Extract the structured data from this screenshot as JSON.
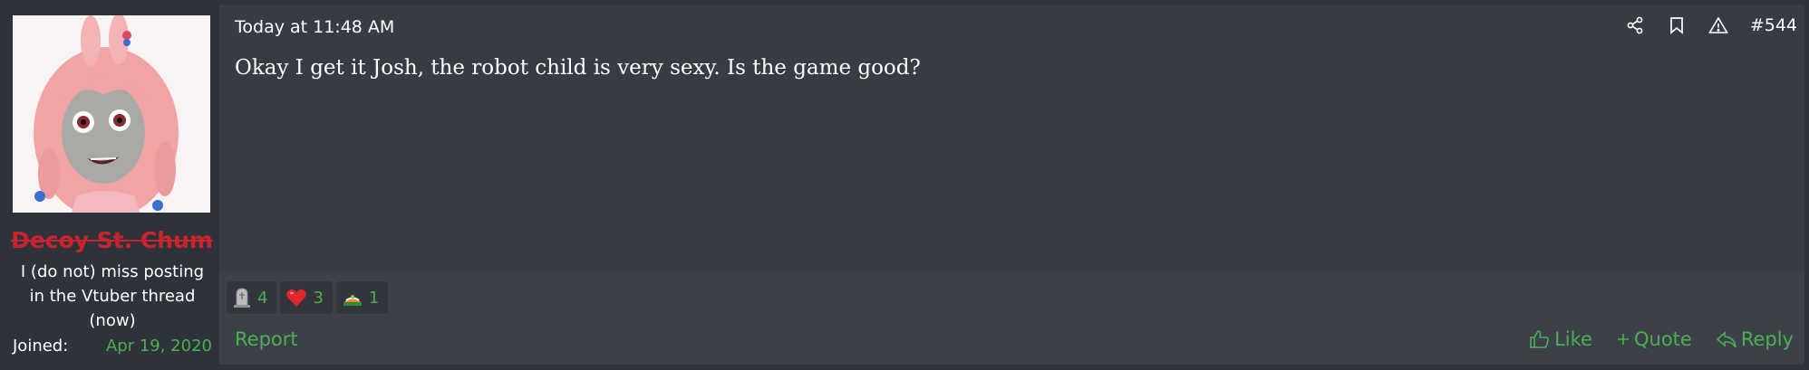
{
  "user": {
    "username": "Decoy St. Chum",
    "title": "I (do not) miss posting in the Vtuber thread (now)",
    "joined_label": "Joined:",
    "joined_date": "Apr 19, 2020"
  },
  "post": {
    "timestamp": "Today at 11:48 AM",
    "number": "#544",
    "message": "Okay I get it Josh, the robot child is very sexy. Is the game good?",
    "icons": [
      "share-icon",
      "bookmark-icon",
      "warning-icon"
    ]
  },
  "reactions": [
    {
      "icon": "tombstone-icon",
      "count": "4"
    },
    {
      "icon": "heart-icon",
      "count": "3"
    },
    {
      "icon": "flag-icon",
      "count": "1"
    }
  ],
  "footer": {
    "report": "Report",
    "like": "Like",
    "quote": "Quote",
    "reply": "Reply"
  },
  "colors": {
    "background": "#373b43",
    "user_cell": "#2e323a",
    "accent_green": "#4caf50",
    "username_red": "#c9232b"
  }
}
